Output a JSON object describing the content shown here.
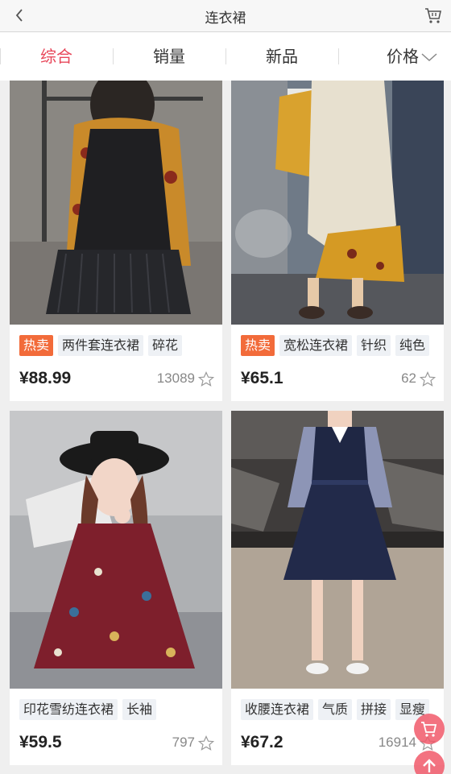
{
  "header": {
    "title": "连衣裙",
    "back_icon": "chevron-left-icon",
    "cart_icon": "cart-icon"
  },
  "sort": {
    "items": [
      "综合",
      "销量",
      "新品",
      "价格"
    ],
    "active": "综合",
    "price_icon": "chevron-down-icon"
  },
  "products": [
    {
      "tags": [
        "热卖",
        "两件套连衣裙",
        "碎花"
      ],
      "hot": true,
      "price": "¥88.99",
      "sales": "13089"
    },
    {
      "tags": [
        "热卖",
        "宽松连衣裙",
        "针织",
        "纯色"
      ],
      "hot": true,
      "price": "¥65.1",
      "sales": "62"
    },
    {
      "tags": [
        "印花雪纺连衣裙",
        "长袖"
      ],
      "hot": false,
      "price": "¥59.5",
      "sales": "797"
    },
    {
      "tags": [
        "收腰连衣裙",
        "气质",
        "拼接",
        "显瘦"
      ],
      "hot": false,
      "price": "¥67.2",
      "sales": "16914"
    }
  ],
  "floating": {
    "cart_icon": "cart-icon",
    "top_icon": "arrow-up-icon",
    "accent": "#f15a6b"
  },
  "colors": {
    "active_sort": "#e8475a",
    "hot_tag": "#f26b3a"
  }
}
